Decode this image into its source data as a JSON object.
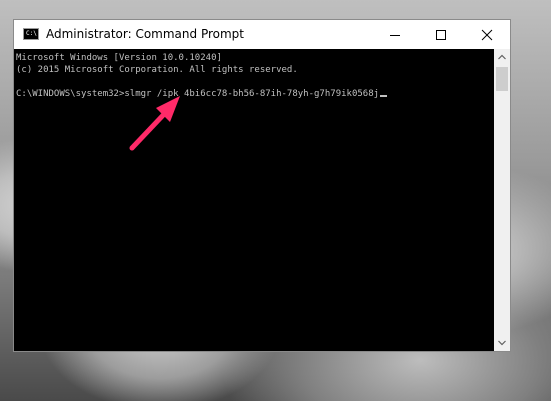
{
  "window": {
    "title": "Administrator: Command Prompt",
    "icon_text": "C:\\"
  },
  "controls": {
    "minimize_icon": "minimize-icon",
    "maximize_icon": "maximize-icon",
    "close_icon": "close-icon"
  },
  "console": {
    "lines": [
      "Microsoft Windows [Version 10.0.10240]",
      "(c) 2015 Microsoft Corporation. All rights reserved.",
      "",
      "C:\\WINDOWS\\system32>slmgr /ipk 4bi6cc78-bh56-87ih-78yh-g7h79ik0568j"
    ]
  },
  "annotation": {
    "arrow_color": "#ff2a68"
  },
  "colors": {
    "console_bg": "#000000",
    "console_text": "#c0c0c0",
    "titlebar_bg": "#ffffff"
  }
}
